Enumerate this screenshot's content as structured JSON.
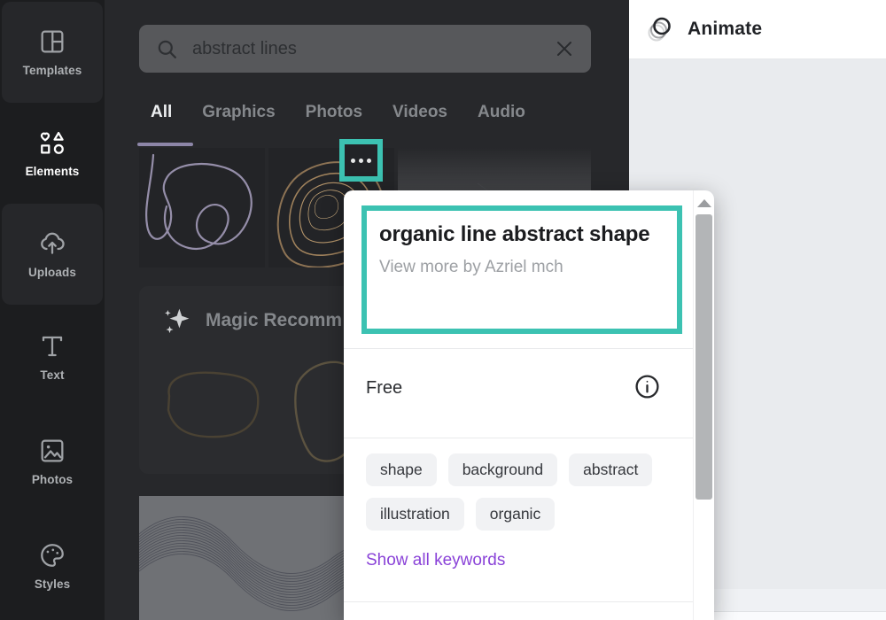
{
  "sidebar": {
    "items": [
      {
        "label": "Templates",
        "active": false
      },
      {
        "label": "Elements",
        "active": true
      },
      {
        "label": "Uploads",
        "active": false
      },
      {
        "label": "Text",
        "active": false
      },
      {
        "label": "Photos",
        "active": false
      },
      {
        "label": "Styles",
        "active": false
      }
    ]
  },
  "search": {
    "value": "abstract lines"
  },
  "tabs": [
    {
      "label": "All",
      "active": true
    },
    {
      "label": "Graphics",
      "active": false
    },
    {
      "label": "Photos",
      "active": false
    },
    {
      "label": "Videos",
      "active": false
    },
    {
      "label": "Audio",
      "active": false
    }
  ],
  "results": {
    "thumbnails": [
      "organic-scribble-line",
      "gold-contour-lines",
      "polygon-mesh-gradient",
      "wave-lines"
    ]
  },
  "magic": {
    "title": "Magic Recomm"
  },
  "popup": {
    "title": "organic line abstract shape",
    "byline": "View more by Azriel mch",
    "license": "Free",
    "keywords": [
      "shape",
      "background",
      "abstract",
      "illustration",
      "organic"
    ],
    "show_all_label": "Show all keywords"
  },
  "editor": {
    "animate_label": "Animate"
  },
  "colors": {
    "annotation_teal": "#3cc2b2",
    "link_purple": "#8a43d8"
  }
}
